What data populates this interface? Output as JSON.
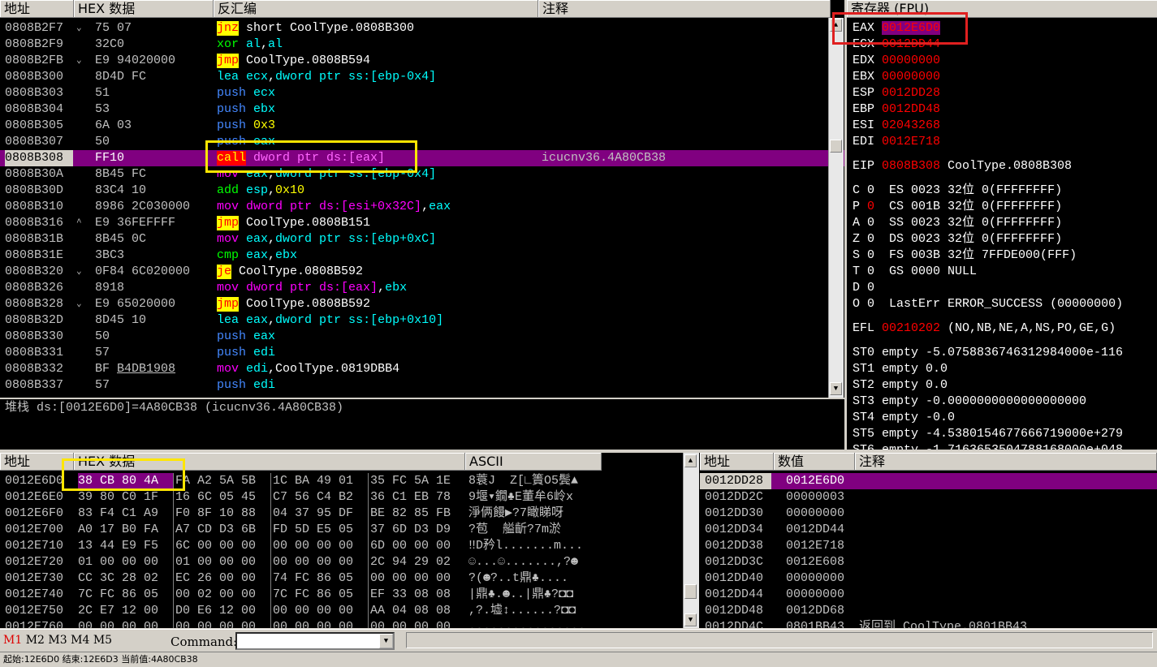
{
  "disasm": {
    "headers": [
      "地址",
      "HEX 数据",
      "反汇编",
      "注释"
    ],
    "rows": [
      {
        "addr": "0808B2F7",
        "mk": "⌄",
        "hex": "75 07",
        "ins": [
          [
            "jnz",
            "kw"
          ],
          [
            " short CoolType.0808B300",
            "wh"
          ]
        ],
        "cmt": ""
      },
      {
        "addr": "0808B2F9",
        "mk": "",
        "hex": "32C0",
        "ins": [
          [
            "xor",
            "gr"
          ],
          [
            " al",
            "cy"
          ],
          [
            ",",
            "wh"
          ],
          [
            "al",
            "cy"
          ]
        ],
        "cmt": ""
      },
      {
        "addr": "0808B2FB",
        "mk": "⌄",
        "hex": "E9 94020000",
        "ins": [
          [
            "jmp",
            "kw"
          ],
          [
            " CoolType.0808B594",
            "wh"
          ]
        ],
        "cmt": ""
      },
      {
        "addr": "0808B300",
        "mk": "",
        "hex": "8D4D FC",
        "ins": [
          [
            "lea",
            "cy"
          ],
          [
            " ecx",
            "cy"
          ],
          [
            ",",
            "wh"
          ],
          [
            "dword ptr ss:[ebp-0x4]",
            "cy"
          ]
        ],
        "cmt": ""
      },
      {
        "addr": "0808B303",
        "mk": "",
        "hex": "51",
        "ins": [
          [
            "push",
            "bl"
          ],
          [
            " ecx",
            "cy"
          ]
        ],
        "cmt": ""
      },
      {
        "addr": "0808B304",
        "mk": "",
        "hex": "53",
        "ins": [
          [
            "push",
            "bl"
          ],
          [
            " ebx",
            "cy"
          ]
        ],
        "cmt": ""
      },
      {
        "addr": "0808B305",
        "mk": "",
        "hex": "6A 03",
        "ins": [
          [
            "push",
            "bl"
          ],
          [
            " 0x3",
            "yl"
          ]
        ],
        "cmt": ""
      },
      {
        "addr": "0808B307",
        "mk": "",
        "hex": "50",
        "ins": [
          [
            "push",
            "bl"
          ],
          [
            " eax",
            "cy"
          ]
        ],
        "cmt": ""
      },
      {
        "addr": "0808B308",
        "mk": "",
        "hex": "FF10",
        "ins": [
          [
            "call",
            "kwr"
          ],
          [
            " dword ptr ds:[eax]",
            "mg"
          ]
        ],
        "cmt": "icucnv36.4A80CB38",
        "sel": true
      },
      {
        "addr": "0808B30A",
        "mk": "",
        "hex": "8B45 FC",
        "ins": [
          [
            "mov",
            "mg"
          ],
          [
            " eax",
            "cy"
          ],
          [
            ",",
            "wh"
          ],
          [
            "dword ptr ss:[ebp-0x4]",
            "cy"
          ]
        ],
        "cmt": ""
      },
      {
        "addr": "0808B30D",
        "mk": "",
        "hex": "83C4 10",
        "ins": [
          [
            "add",
            "gr"
          ],
          [
            " esp",
            "cy"
          ],
          [
            ",",
            "wh"
          ],
          [
            "0x10",
            "yl"
          ]
        ],
        "cmt": ""
      },
      {
        "addr": "0808B310",
        "mk": "",
        "hex": "8986 2C030000",
        "ins": [
          [
            "mov",
            "mg"
          ],
          [
            " dword ptr ds:[esi+0x32C]",
            "mg"
          ],
          [
            ",",
            "wh"
          ],
          [
            "eax",
            "cy"
          ]
        ],
        "cmt": ""
      },
      {
        "addr": "0808B316",
        "mk": "^",
        "hex": "E9 36FEFFFF",
        "ins": [
          [
            "jmp",
            "kw"
          ],
          [
            " CoolType.0808B151",
            "wh"
          ]
        ],
        "cmt": ""
      },
      {
        "addr": "0808B31B",
        "mk": "",
        "hex": "8B45 0C",
        "ins": [
          [
            "mov",
            "mg"
          ],
          [
            " eax",
            "cy"
          ],
          [
            ",",
            "wh"
          ],
          [
            "dword ptr ss:[ebp+0xC]",
            "cy"
          ]
        ],
        "cmt": ""
      },
      {
        "addr": "0808B31E",
        "mk": "",
        "hex": "3BC3",
        "ins": [
          [
            "cmp",
            "gr"
          ],
          [
            " eax",
            "cy"
          ],
          [
            ",",
            "wh"
          ],
          [
            "ebx",
            "cy"
          ]
        ],
        "cmt": ""
      },
      {
        "addr": "0808B320",
        "mk": "⌄",
        "hex": "0F84 6C020000",
        "ins": [
          [
            "je",
            "kw"
          ],
          [
            " CoolType.0808B592",
            "wh"
          ]
        ],
        "cmt": ""
      },
      {
        "addr": "0808B326",
        "mk": "",
        "hex": "8918",
        "ins": [
          [
            "mov",
            "mg"
          ],
          [
            " dword ptr ds:[eax]",
            "mg"
          ],
          [
            ",",
            "wh"
          ],
          [
            "ebx",
            "cy"
          ]
        ],
        "cmt": ""
      },
      {
        "addr": "0808B328",
        "mk": "⌄",
        "hex": "E9 65020000",
        "ins": [
          [
            "jmp",
            "kw"
          ],
          [
            " CoolType.0808B592",
            "wh"
          ]
        ],
        "cmt": ""
      },
      {
        "addr": "0808B32D",
        "mk": "",
        "hex": "8D45 10",
        "ins": [
          [
            "lea",
            "cy"
          ],
          [
            " eax",
            "cy"
          ],
          [
            ",",
            "wh"
          ],
          [
            "dword ptr ss:[ebp+0x10]",
            "cy"
          ]
        ],
        "cmt": ""
      },
      {
        "addr": "0808B330",
        "mk": "",
        "hex": "50",
        "ins": [
          [
            "push",
            "bl"
          ],
          [
            " eax",
            "cy"
          ]
        ],
        "cmt": ""
      },
      {
        "addr": "0808B331",
        "mk": "",
        "hex": "57",
        "ins": [
          [
            "push",
            "bl"
          ],
          [
            " edi",
            "cy"
          ]
        ],
        "cmt": ""
      },
      {
        "addr": "0808B332",
        "mk": "",
        "hex": "BF B4DB1908",
        "ins": [
          [
            "mov",
            "mg"
          ],
          [
            " edi",
            "cy"
          ],
          [
            ",",
            "wh"
          ],
          [
            "CoolType.0819DBB4",
            "wh"
          ]
        ],
        "cmt": "",
        "ul": "B4DB1908"
      },
      {
        "addr": "0808B337",
        "mk": "",
        "hex": "57",
        "ins": [
          [
            "push",
            "bl"
          ],
          [
            " edi",
            "cy"
          ]
        ],
        "cmt": ""
      }
    ]
  },
  "info_line": "堆栈 ds:[0012E6D0]=4A80CB38 (icucnv36.4A80CB38)",
  "regs": {
    "header": "寄存器 (FPU)",
    "gp": [
      [
        "EAX",
        "0012E6D0"
      ],
      [
        "ECX",
        "0012DD44"
      ],
      [
        "EDX",
        "00000000"
      ],
      [
        "EBX",
        "00000000"
      ],
      [
        "ESP",
        "0012DD28"
      ],
      [
        "EBP",
        "0012DD48"
      ],
      [
        "ESI",
        "02043268"
      ],
      [
        "EDI",
        "0012E718"
      ]
    ],
    "eip": [
      "EIP",
      "0808B308",
      "CoolType.0808B308"
    ],
    "flags": [
      [
        "C",
        "0",
        "ES 0023 32位 0(FFFFFFFF)"
      ],
      [
        "P",
        "0",
        "CS 001B 32位 0(FFFFFFFF)"
      ],
      [
        "A",
        "0",
        "SS 0023 32位 0(FFFFFFFF)"
      ],
      [
        "Z",
        "0",
        "DS 0023 32位 0(FFFFFFFF)"
      ],
      [
        "S",
        "0",
        "FS 003B 32位 7FFDE000(FFF)"
      ],
      [
        "T",
        "0",
        "GS 0000 NULL"
      ],
      [
        "D",
        "0",
        ""
      ],
      [
        "O",
        "0",
        "LastErr ERROR_SUCCESS (00000000)"
      ]
    ],
    "efl": [
      "EFL",
      "00210202",
      "(NO,NB,NE,A,NS,PO,GE,G)"
    ],
    "st": [
      "ST0 empty -5.0758836746312984000e-116",
      "ST1 empty 0.0",
      "ST2 empty 0.0",
      "ST3 empty -0.0000000000000000000",
      "ST4 empty -0.0",
      "ST5 empty -4.5380154677666719000e+279",
      "ST6 empty -1.7163653504788168000e+048"
    ]
  },
  "dump": {
    "headers": [
      "地址",
      "HEX 数据",
      "ASCII"
    ],
    "rows": [
      {
        "addr": "0012E6D0",
        "hex": [
          "38 CB 80 4A",
          "FA A2 5A 5B",
          "1C BA 49 01",
          "35 FC 5A 1E"
        ],
        "asc": "8蓑J  Z[∟簀O5鬓▲"
      },
      {
        "addr": "0012E6E0",
        "hex": [
          "39 80 C0 1F",
          "16 6C 05 45",
          "C7 56 C4 B2",
          "36 C1 EB 78"
        ],
        "asc": "9堰▾鐗♣E董牟6岭x"
      },
      {
        "addr": "0012E6F0",
        "hex": [
          "83 F4 C1 A9",
          "F0 8F 10 88",
          "04 37 95 DF",
          "BE 82 85 FB"
        ],
        "asc": "淨俩饅▶?7瞰睇呀"
      },
      {
        "addr": "0012E700",
        "hex": [
          "A0 17 B0 FA",
          "A7 CD D3 6B",
          "FD 5D E5 05",
          "37 6D D3 D9"
        ],
        "asc": "?苞  艗齗?7m淤"
      },
      {
        "addr": "0012E710",
        "hex": [
          "13 44 E9 F5",
          "6C 00 00 00",
          "00 00 00 00",
          "6D 00 00 00"
        ],
        "asc": "‼D矜l.......m..."
      },
      {
        "addr": "0012E720",
        "hex": [
          "01 00 00 00",
          "01 00 00 00",
          "00 00 00 00",
          "2C 94 29 02"
        ],
        "asc": "☺...☺.......,?☻"
      },
      {
        "addr": "0012E730",
        "hex": [
          "CC 3C 28 02",
          "EC 26 00 00",
          "74 FC 86 05",
          "00 00 00 00"
        ],
        "asc": "?(☻?..t鼎♣...."
      },
      {
        "addr": "0012E740",
        "hex": [
          "7C FC 86 05",
          "00 02 00 00",
          "7C FC 86 05",
          "EF 33 08 08"
        ],
        "asc": "|鼎♣.☻..|鼎♣?◘◘"
      },
      {
        "addr": "0012E750",
        "hex": [
          "2C E7 12 00",
          "D0 E6 12 00",
          "00 00 00 00",
          "AA 04 08 08"
        ],
        "asc": ",?.墟↕......?◘◘"
      },
      {
        "addr": "0012E760",
        "hex": [
          "00 00 00 00",
          "00 00 00 00",
          "00 00 00 00",
          "00 00 00 00"
        ],
        "asc": "................"
      }
    ]
  },
  "stack": {
    "headers": [
      "地址",
      "数值",
      "注释"
    ],
    "rows": [
      [
        "0012DD28",
        "0012E6D0",
        ""
      ],
      [
        "0012DD2C",
        "00000003",
        ""
      ],
      [
        "0012DD30",
        "00000000",
        ""
      ],
      [
        "0012DD34",
        "0012DD44",
        ""
      ],
      [
        "0012DD38",
        "0012E718",
        ""
      ],
      [
        "0012DD3C",
        "0012E608",
        ""
      ],
      [
        "0012DD40",
        "00000000",
        ""
      ],
      [
        "0012DD44",
        "00000000",
        ""
      ],
      [
        "0012DD48",
        "0012DD68",
        ""
      ],
      [
        "0012DD4C",
        "0801BB43",
        "返回到 CoolType.0801BB43"
      ]
    ]
  },
  "cmdbar": {
    "tabs": [
      "M1",
      "M2",
      "M3",
      "M4",
      "M5"
    ],
    "label": "Command:"
  },
  "status": "起始:12E6D0 结束:12E6D3 当前值:4A80CB38",
  "icons": [
    "scroll-up-icon",
    "scroll-down-icon",
    "dropdown-arrow-icon"
  ],
  "colors": {
    "selected_row": "#800080",
    "highlight_yellow": "#ffe600",
    "highlight_red": "#e02020"
  }
}
